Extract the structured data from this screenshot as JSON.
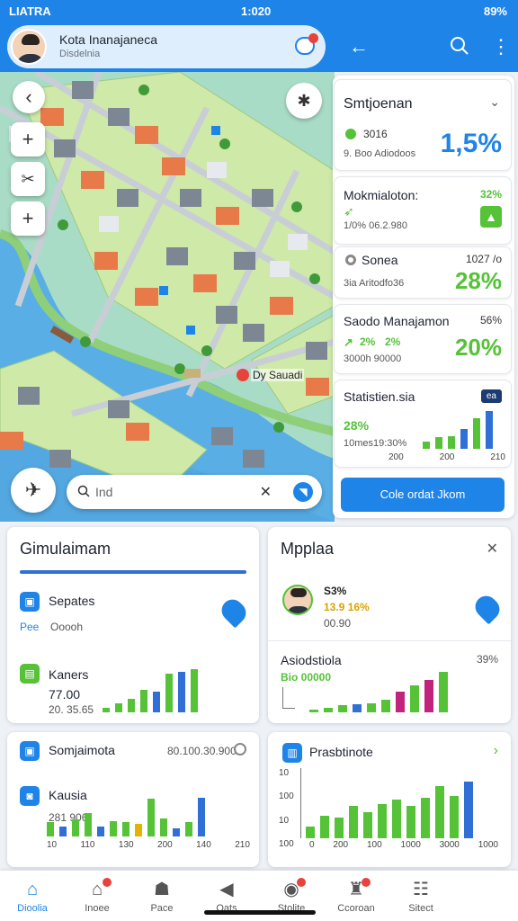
{
  "status": {
    "left": "LIATRA",
    "center": "1:020",
    "right": "89%"
  },
  "profile": {
    "name": "Kota Inanajaneca",
    "subtitle": "Disdelnia"
  },
  "colors": {
    "primary": "#1f84e8",
    "green": "#55c238",
    "blue": "#2f6fd6",
    "magenta": "#c2237c",
    "red": "#e8423d"
  },
  "map": {
    "marker_label": "Dy Sauadi",
    "search_placeholder": "Ind"
  },
  "side": {
    "header": {
      "title": "Smtjoenan",
      "line1": "3016",
      "line2": "9. Boo Adiodoos",
      "value": "1,5%"
    },
    "card2": {
      "title": "Mokmialoton:",
      "pct": "32%",
      "line": "1/0% 06.2.980"
    },
    "card3": {
      "title": "Sonea",
      "num": "1027 /o",
      "sub": "3ia Aritodfo36",
      "value": "28%"
    },
    "card4": {
      "title": "Saodo Manajamon",
      "pct": "56%",
      "num": "2%",
      "line": "2%",
      "sub": "3000h 90000",
      "value": "20%"
    },
    "card5": {
      "title": "Statistien.sia",
      "badge": "ea",
      "pct": "28%",
      "sub": "10mes19:30%",
      "axis": [
        "200",
        "200",
        "210"
      ]
    },
    "button": "Cole ordat Jkom"
  },
  "card_sim": {
    "title": "Gimulaimam",
    "item1": {
      "label": "Sepates",
      "a": "Pee",
      "b": "Ooooh"
    },
    "item2": {
      "label": "Kaners",
      "value": "77.00",
      "sub": "20. 35.65"
    }
  },
  "card_pop": {
    "title": "Mpplaa",
    "row1": {
      "a": "S3%",
      "b": "13.9 16%",
      "c": "00.90"
    },
    "stat_title": "Asiodstiola",
    "stat_pct": "39%",
    "stat_sub": "Bio 00000"
  },
  "card_so": {
    "title": "Somjaimota",
    "meta": "80.100.30.900",
    "item": "Kausia",
    "sub": "281 906",
    "axis": [
      "10",
      "110",
      "130",
      "200",
      "140",
      "210"
    ]
  },
  "card_pr": {
    "title": "Prasbtinote",
    "yaxis": [
      "10",
      "100",
      "10",
      "100"
    ],
    "axis": [
      "0",
      "200",
      "100",
      "1000",
      "3000",
      "1000"
    ]
  },
  "chart_data": [
    {
      "type": "bar",
      "values": [
        35,
        55,
        60,
        90,
        140,
        175
      ],
      "ylim": [
        0,
        200
      ]
    },
    {
      "type": "bar",
      "values": [
        20,
        40,
        60,
        100,
        90,
        170,
        180,
        190
      ],
      "ylim": [
        0,
        200
      ]
    },
    {
      "type": "bar",
      "values": [
        10,
        20,
        30,
        35,
        40,
        55,
        90,
        120,
        145,
        180
      ],
      "ylim": [
        0,
        200
      ]
    },
    {
      "type": "bar",
      "values": [
        50,
        35,
        60,
        85,
        35,
        55,
        50,
        45,
        135,
        65,
        30,
        50,
        140
      ],
      "ylim": [
        0,
        200
      ]
    },
    {
      "type": "bar",
      "values": [
        35,
        70,
        65,
        100,
        80,
        105,
        120,
        100,
        125,
        160,
        130,
        175
      ],
      "ylim": [
        0,
        200
      ]
    }
  ],
  "nav": [
    {
      "label": "Dioolia",
      "icon": "home-icon"
    },
    {
      "label": "Inoee",
      "icon": "house-icon"
    },
    {
      "label": "Pace",
      "icon": "users-icon"
    },
    {
      "label": "Oats",
      "icon": "back-circle-icon"
    },
    {
      "label": "Stolite",
      "icon": "alert-icon"
    },
    {
      "label": "Ccoroan",
      "icon": "person-icon"
    },
    {
      "label": "Sitect",
      "icon": "group-icon"
    }
  ]
}
